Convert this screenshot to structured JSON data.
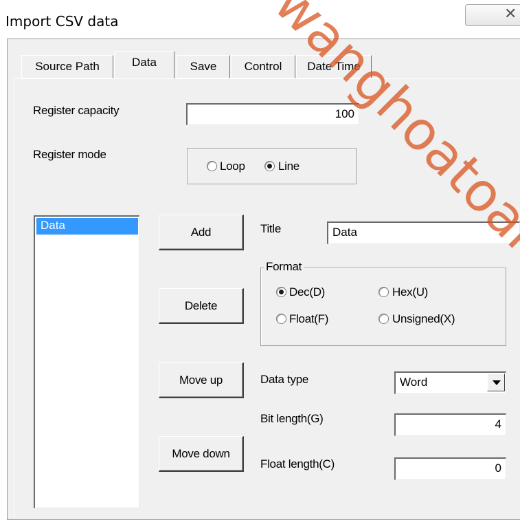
{
  "window": {
    "title": "Import CSV data",
    "close_glyph": "✕"
  },
  "tabs": [
    {
      "label": "Source Path"
    },
    {
      "label": "Data"
    },
    {
      "label": "Save"
    },
    {
      "label": "Control"
    },
    {
      "label": "Date Time"
    }
  ],
  "data_tab": {
    "register_capacity_label": "Register capacity",
    "register_capacity_value": "100",
    "register_mode_label": "Register mode",
    "mode_loop_label": "Loop",
    "mode_line_label": "Line",
    "mode_selected": "Line",
    "list_items": [
      "Data"
    ],
    "add_button": "Add",
    "delete_button": "Delete",
    "move_up_button": "Move up",
    "move_down_button": "Move down",
    "title_label": "Title",
    "title_value": "Data",
    "format_caption": "Format",
    "format_dec": "Dec(D)",
    "format_hex": "Hex(U)",
    "format_float": "Float(F)",
    "format_unsigned": "Unsigned(X)",
    "format_selected": "Dec(D)",
    "data_type_label": "Data type",
    "data_type_value": "Word",
    "bit_length_label": "Bit length(G)",
    "bit_length_value": "4",
    "float_length_label": "Float length(C)",
    "float_length_value": "0"
  },
  "watermark_text": "wanghoatoan",
  "colors": {
    "dialog_bg": "#f0f0f0",
    "selection": "#3399ff",
    "watermark": "#d9541e"
  }
}
